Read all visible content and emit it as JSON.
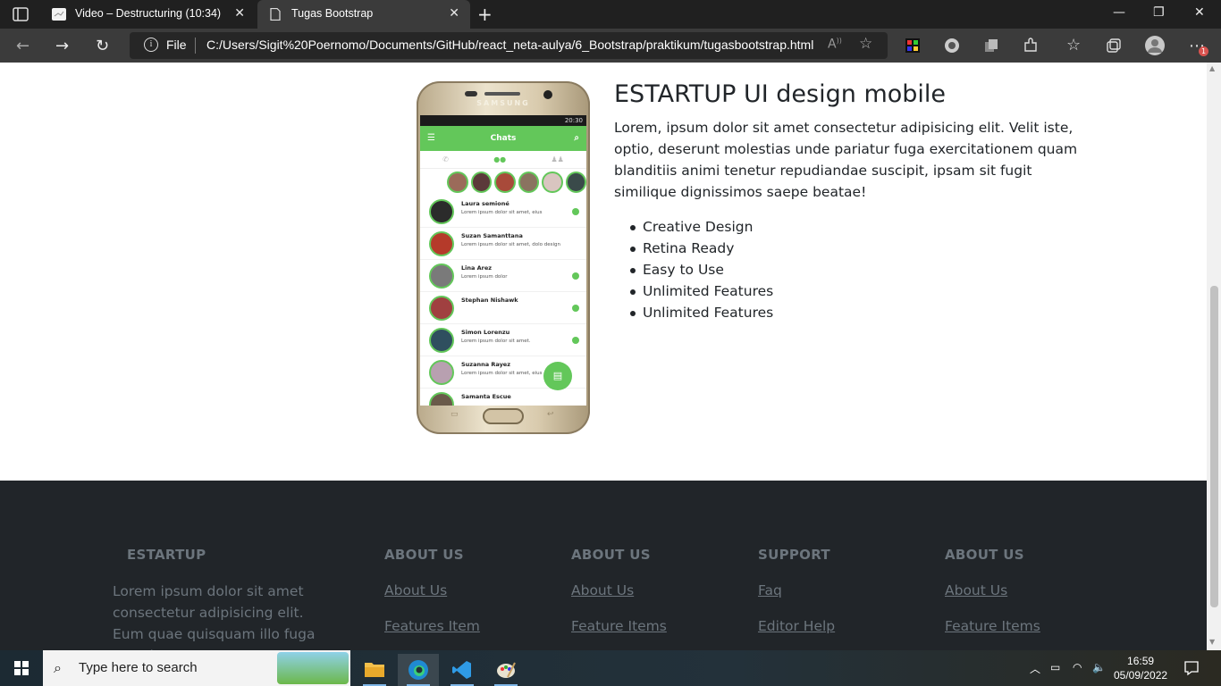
{
  "browser": {
    "tabs": [
      {
        "title": "Video – Destructuring (10:34)",
        "active": false
      },
      {
        "title": "Tugas Bootstrap",
        "active": true
      }
    ],
    "new_tab": "+",
    "address": {
      "scheme": "File",
      "url": "C:/Users/Sigit%20Poernomo/Documents/GitHub/react_neta-aulya/6_Bootstrap/praktikum/tugasbootstrap.html"
    },
    "window_controls": {
      "minimize": "—",
      "restore": "❐",
      "close": "✕"
    },
    "notification_badge": "1"
  },
  "page": {
    "feature": {
      "title": "ESTARTUP UI design mobile",
      "description": "Lorem, ipsum dolor sit amet consectetur adipisicing elit. Velit iste, optio, deserunt molestias unde pariatur fuga exercitationem quam blanditiis animi tenetur repudiandae suscipit, ipsam sit fugit similique dignissimos saepe beatae!",
      "list": [
        "Creative Design",
        "Retina Ready",
        "Easy to Use",
        "Unlimited Features",
        "Unlimited Features"
      ],
      "phone": {
        "brand": "SAMSUNG",
        "status_time": "20:30",
        "app_title": "Chats",
        "chats": [
          {
            "name": "Laura semioné",
            "message": "Lorem ipsum dolor sit amet, eius"
          },
          {
            "name": "Suzan Samanttana",
            "message": "Lorem ipsum dolor sit amet, dolo design"
          },
          {
            "name": "Lina Arez",
            "message": "Lorem ipsum dolor"
          },
          {
            "name": "Stephan Nishawk",
            "message": ""
          },
          {
            "name": "Simon Lorenzu",
            "message": "Lorem ipsum dolor sit amet."
          },
          {
            "name": "Suzanna Rayez",
            "message": "Lorem ipsum dolor sit amet, eius"
          },
          {
            "name": "Samanta Escue",
            "message": ""
          }
        ]
      }
    },
    "footer": {
      "brand": {
        "heading": "ESTARTUP",
        "text": "Lorem ipsum dolor sit amet consectetur adipisicing elit. Eum quae quisquam illo fuga ea soluta"
      },
      "columns": [
        {
          "heading": "ABOUT US",
          "links": [
            "About Us",
            "Features Item"
          ]
        },
        {
          "heading": "ABOUT US",
          "links": [
            "About Us",
            "Feature Items"
          ]
        },
        {
          "heading": "SUPPORT",
          "links": [
            "Faq",
            "Editor Help"
          ]
        },
        {
          "heading": "ABOUT US",
          "links": [
            "About Us",
            "Feature Items"
          ]
        }
      ]
    }
  },
  "taskbar": {
    "search_placeholder": "Type here to search",
    "time": "16:59",
    "date": "05/09/2022"
  },
  "colors": {
    "footer_bg": "#212529",
    "footer_text": "#6c757d",
    "app_green": "#63c75a"
  }
}
